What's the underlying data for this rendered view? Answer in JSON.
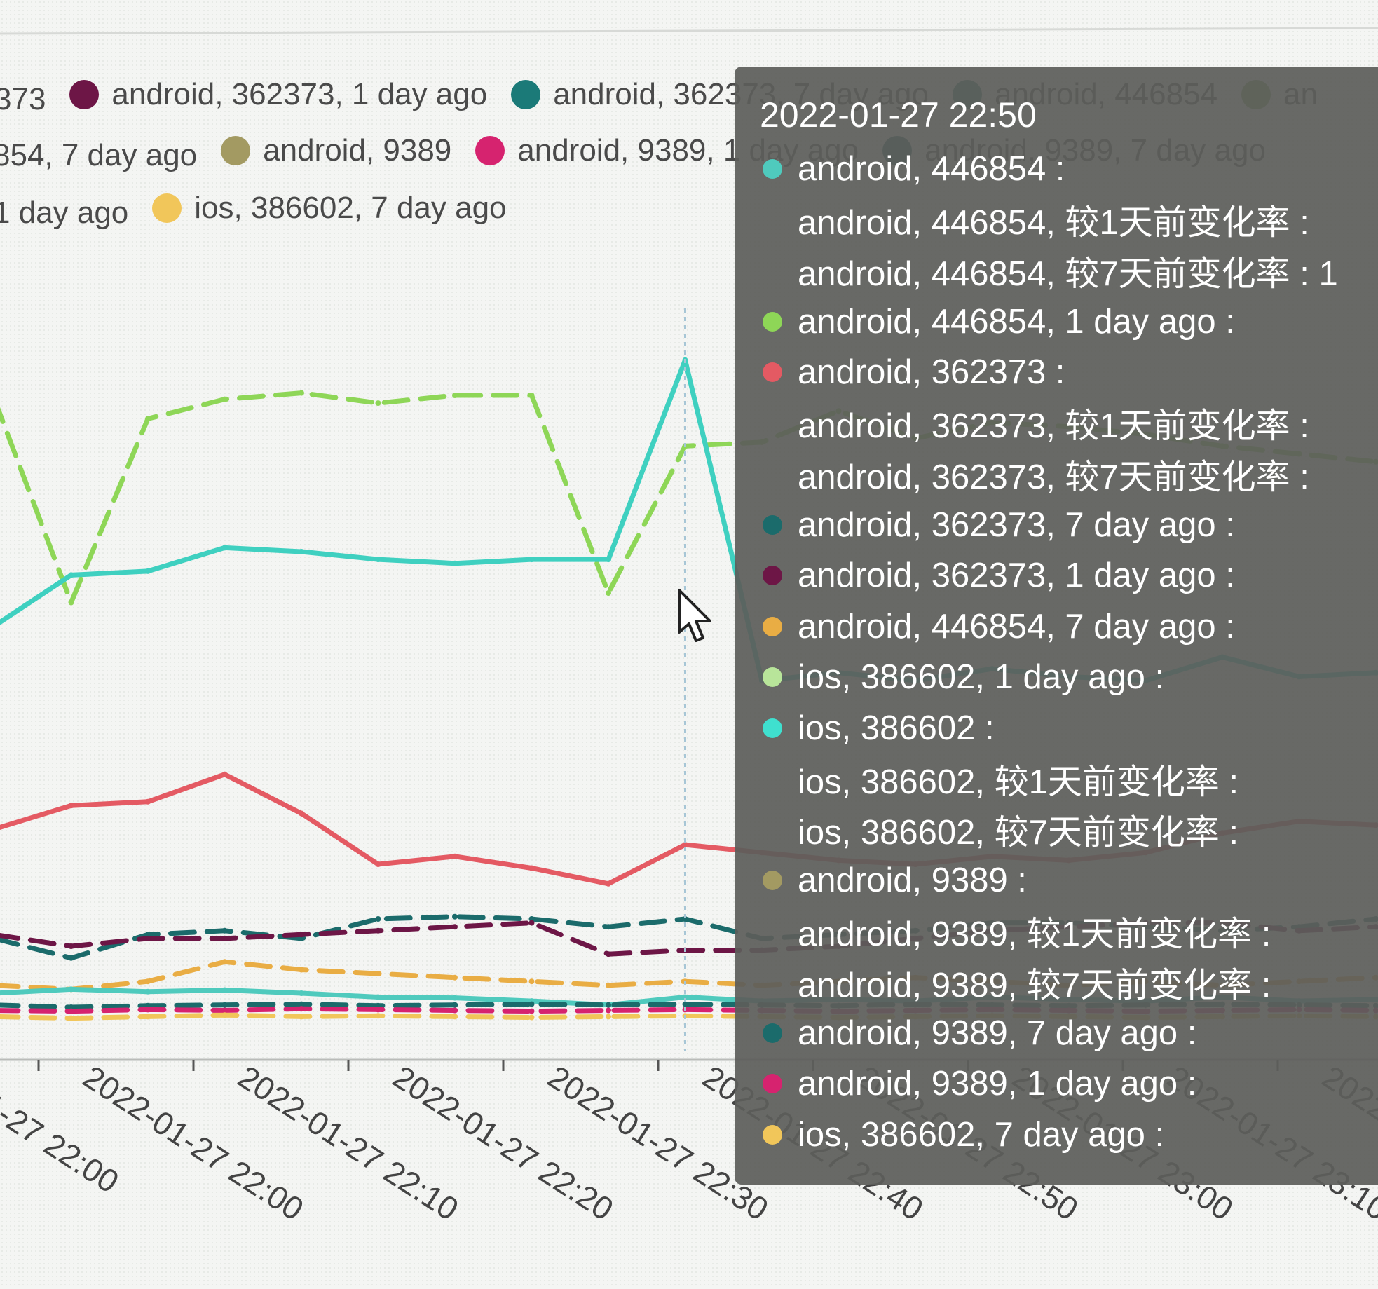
{
  "chart_data": {
    "type": "line",
    "legend": {
      "rows": [
        [
          {
            "label": "android, 362373, 1 day ago",
            "color": "#6d1646",
            "shown": "373"
          },
          {
            "label": "android, 362373, 1 day ago",
            "color": "#6d1646"
          },
          {
            "label": "android, 362373, 7 day ago",
            "color": "#1b7a78"
          },
          {
            "label": "android, 446854",
            "color": "#2a7f70"
          },
          {
            "label": "an",
            "color": "#7aa35a"
          }
        ],
        [
          {
            "label": "854, 7 day ago",
            "color": null
          },
          {
            "label": "android, 9389",
            "color": "#a39a62"
          },
          {
            "label": "android, 9389, 1 day ago",
            "color": "#d6236f"
          },
          {
            "label": "android, 9389, 7 day ago",
            "color": "#1b6b6b"
          }
        ],
        [
          {
            "label": "1 day ago",
            "color": null
          },
          {
            "label": "ios, 386602, 7 day ago",
            "color": "#f1c65a"
          }
        ]
      ]
    },
    "x_ticks": [
      "2022-01-27 22:00",
      "2022-01-27 22:10",
      "2022-01-27 22:20",
      "2022-01-27 22:30",
      "2022-01-27 22:40",
      "2022-01-27 22:50",
      "2022-01-27 23:00",
      "2022-01-27 23:10",
      "2022-01-27 23:2"
    ],
    "x": [
      0,
      1,
      2,
      3,
      4,
      5,
      6,
      7,
      8,
      9,
      10,
      11,
      12,
      13,
      14,
      15,
      16,
      17,
      18
    ],
    "series": [
      {
        "name": "ios, 386602, 1 day ago",
        "color": "#8ed657",
        "dash": true,
        "values": [
          830,
          570,
          805,
          830,
          838,
          825,
          835,
          835,
          582,
          770,
          775,
          815,
          780,
          800,
          795,
          785,
          770,
          760,
          750
        ]
      },
      {
        "name": "ios, 386602",
        "color": "#3fd0c0",
        "dash": false,
        "values": [
          540,
          605,
          610,
          640,
          635,
          625,
          620,
          625,
          625,
          880,
          470,
          480,
          470,
          485,
          475,
          470,
          500,
          475,
          480
        ]
      },
      {
        "name": "android, 362373",
        "color": "#e45a63",
        "dash": false,
        "values": [
          280,
          310,
          315,
          350,
          300,
          235,
          245,
          230,
          210,
          260,
          250,
          240,
          235,
          245,
          240,
          250,
          275,
          290,
          285
        ]
      },
      {
        "name": "android, 362373, 7 day ago",
        "color": "#1b6b6b",
        "dash": true,
        "values": [
          140,
          115,
          145,
          150,
          140,
          165,
          168,
          165,
          155,
          165,
          140,
          145,
          150,
          160,
          160,
          155,
          150,
          155,
          165
        ]
      },
      {
        "name": "android, 362373, 1 day ago",
        "color": "#6d1646",
        "dash": true,
        "values": [
          145,
          130,
          140,
          140,
          145,
          150,
          155,
          160,
          120,
          125,
          125,
          130,
          140,
          150,
          155,
          160,
          160,
          150,
          155
        ]
      },
      {
        "name": "android, 446854, 7 day ago",
        "color": "#e9ad44",
        "dash": true,
        "values": [
          80,
          75,
          85,
          110,
          100,
          95,
          90,
          85,
          80,
          85,
          80,
          85,
          90,
          85,
          80,
          85,
          80,
          85,
          90
        ]
      },
      {
        "name": "android, 446854",
        "color": "#4fcabd",
        "dash": false,
        "values": [
          70,
          75,
          72,
          74,
          70,
          65,
          64,
          60,
          55,
          65,
          60,
          62,
          60,
          65,
          62,
          60,
          65,
          60,
          62
        ]
      },
      {
        "name": "android, 9389, 7 day ago",
        "color": "#1b6b6b",
        "dash": true,
        "values": [
          55,
          52,
          54,
          55,
          56,
          54,
          55,
          56,
          55,
          56,
          55,
          54,
          56,
          55,
          54,
          55,
          56,
          55,
          54
        ]
      },
      {
        "name": "android, 9389, 1 day ago",
        "color": "#d6236f",
        "dash": true,
        "values": [
          48,
          47,
          49,
          48,
          50,
          49,
          48,
          47,
          48,
          49,
          48,
          47,
          48,
          49,
          48,
          47,
          48,
          49,
          48
        ]
      },
      {
        "name": "ios, 386602, 7 day ago",
        "color": "#f1c65a",
        "dash": true,
        "values": [
          40,
          38,
          40,
          42,
          40,
          41,
          40,
          39,
          40,
          41,
          40,
          39,
          40,
          41,
          40,
          39,
          40,
          41,
          40
        ]
      }
    ],
    "tooltip": {
      "title": "2022-01-27 22:50",
      "rows": [
        {
          "text": "android, 446854 :",
          "color": "#4fcabd"
        },
        {
          "text": "android, 446854, 较1天前变化率 :",
          "color": null
        },
        {
          "text": "android, 446854, 较7天前变化率 : 1",
          "color": null
        },
        {
          "text": "android, 446854, 1 day ago :",
          "color": "#8ed657"
        },
        {
          "text": "android, 362373 :",
          "color": "#e45a63"
        },
        {
          "text": "android, 362373, 较1天前变化率 :",
          "color": null
        },
        {
          "text": "android, 362373, 较7天前变化率 :",
          "color": null
        },
        {
          "text": "android, 362373, 7 day ago :",
          "color": "#1b6b6b"
        },
        {
          "text": "android, 362373, 1 day ago :",
          "color": "#6d1646"
        },
        {
          "text": "android, 446854, 7 day ago :",
          "color": "#e9ad44"
        },
        {
          "text": "ios, 386602, 1 day ago :",
          "color": "#b8e59a"
        },
        {
          "text": "ios, 386602 :",
          "color": "#3fe0cf"
        },
        {
          "text": "ios, 386602, 较1天前变化率 :",
          "color": null
        },
        {
          "text": "ios, 386602, 较7天前变化率 :",
          "color": null
        },
        {
          "text": "android, 9389 :",
          "color": "#a39a62"
        },
        {
          "text": "android, 9389, 较1天前变化率 :",
          "color": null
        },
        {
          "text": "android, 9389, 较7天前变化率 :",
          "color": null
        },
        {
          "text": "android, 9389, 7 day ago :",
          "color": "#1b6b6b"
        },
        {
          "text": "android, 9389, 1 day ago :",
          "color": "#d6236f"
        },
        {
          "text": "ios, 386602, 7 day ago :",
          "color": "#f1c65a"
        }
      ]
    }
  }
}
